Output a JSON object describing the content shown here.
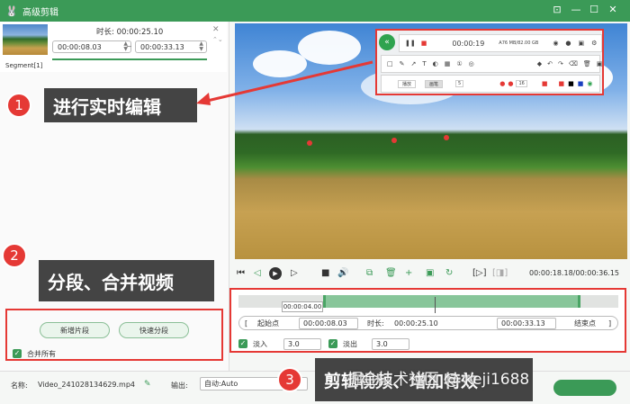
{
  "window": {
    "title": "高级剪辑",
    "logo_icon": "🐰",
    "controls": {
      "skin": "⊡",
      "min": "—",
      "max": "☐",
      "close": "✕"
    }
  },
  "segment": {
    "label": "Segment[1]",
    "duration_label": "时长: ",
    "duration": "00:00:25.10",
    "start": "00:00:08.03",
    "separator": "~",
    "end": "00:00:33.13",
    "close": "✕",
    "move": "⌃⌄"
  },
  "player": {
    "time": "00:00:18.18/00:00:36.15",
    "controls": [
      "⏮",
      "◁",
      "▶",
      "▷",
      "■",
      "🔊",
      "⧉",
      "🗑",
      "+",
      "▣",
      "↻",
      "[▷]",
      "[◨]"
    ]
  },
  "recorder": {
    "time": "00:00:19",
    "size": "A76 MB/82.00 GB",
    "tab1": "播放",
    "tab2": "画笔",
    "size_value": "16",
    "pen_value": "5"
  },
  "timeline": {
    "tooltip": "00:00:04.00",
    "start_label": "起始点",
    "start_value": "00:00:08.03",
    "duration_label": "时长:",
    "duration_value": "00:00:25.10",
    "end_value": "00:00:33.13",
    "end_label": "结束点",
    "left_bracket": "[",
    "right_bracket": "]"
  },
  "fade": {
    "in_label": "淡入",
    "in_value": "3.0",
    "out_label": "淡出",
    "out_value": "3.0",
    "check": "✓"
  },
  "segment_actions": {
    "new_segment": "新增片段",
    "quick_split": "快速分段",
    "merge_all": "合并所有"
  },
  "bottom": {
    "name_label": "名称:",
    "filename": "Video_241028134629.mp4",
    "edit_icon": "✎",
    "output_label": "输出:",
    "output_value": "自动:Auto"
  },
  "callouts": [
    {
      "num": "1",
      "text": "进行实时编辑"
    },
    {
      "num": "2",
      "text": "分段、合并视频"
    },
    {
      "num": "3",
      "text": "剪辑视频、增加特效"
    }
  ],
  "watermark": "掘金技术社区 @ keji1688",
  "colors": {
    "accent": "#3b9a57",
    "highlight": "#e53935"
  }
}
